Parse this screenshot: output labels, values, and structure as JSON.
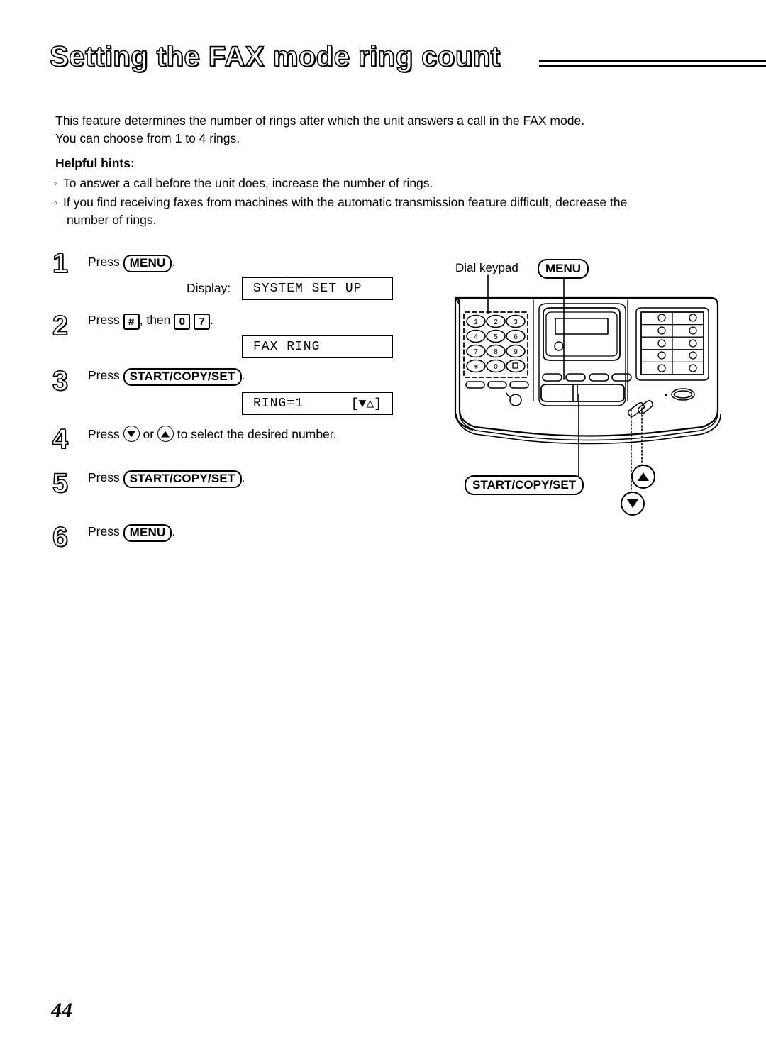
{
  "document": {
    "title": "Setting the FAX mode ring count",
    "page_number": "44"
  },
  "intro": {
    "line1": "This feature determines the number of rings after which the unit answers a call in the FAX mode.",
    "line2": "You can choose from 1 to 4 rings."
  },
  "hints": {
    "heading": "Helpful hints:",
    "bullet_glyph": "◦",
    "items": [
      {
        "text": "To answer a call before the unit does, increase the number of rings.",
        "cont": ""
      },
      {
        "text": "If you find receiving faxes from machines with the automatic transmission feature difficult, decrease the",
        "cont": "number of rings."
      }
    ]
  },
  "steps": [
    {
      "number": "1",
      "press_word": "Press",
      "key": "MENU",
      "period": ".",
      "display_label": "Display:",
      "lcd": {
        "left": "SYSTEM SET UP",
        "right": ""
      }
    },
    {
      "number": "2",
      "press_word": "Press",
      "key_hash": "#",
      "then_word": ", then",
      "key_0": "0",
      "key_7": "7",
      "period": ".",
      "lcd": {
        "left": "FAX RING",
        "right": ""
      }
    },
    {
      "number": "3",
      "press_word": "Press",
      "key": "START/COPY/SET",
      "period": ".",
      "lcd": {
        "left": "RING=1",
        "right": "[▼△]"
      }
    },
    {
      "number": "4",
      "press_word": "Press",
      "or_word": "or",
      "tail_text": "to select the desired number.",
      "down_icon": "arrow-down-button-icon",
      "up_icon": "arrow-up-button-icon"
    },
    {
      "number": "5",
      "press_word": "Press",
      "key": "START/COPY/SET",
      "period": "."
    },
    {
      "number": "6",
      "press_word": "Press",
      "key": "MENU",
      "period": "."
    }
  ],
  "figure": {
    "name": "fax-machine-control-panel-diagram",
    "callouts": {
      "dial_keypad": "Dial keypad",
      "menu": "MENU",
      "start_copy_set": "START/COPY/SET"
    },
    "keypad": {
      "rows": [
        [
          "1",
          "2",
          "3"
        ],
        [
          "4",
          "5",
          "6"
        ],
        [
          "7",
          "8",
          "9"
        ],
        [
          "∗",
          "0",
          "■"
        ]
      ]
    },
    "one_touch_keys": {
      "rows": 5,
      "cols": 2
    },
    "soft_buttons": 4,
    "left_small_buttons": 3
  },
  "colors": {
    "ink": "#000000",
    "paper": "#ffffff"
  }
}
